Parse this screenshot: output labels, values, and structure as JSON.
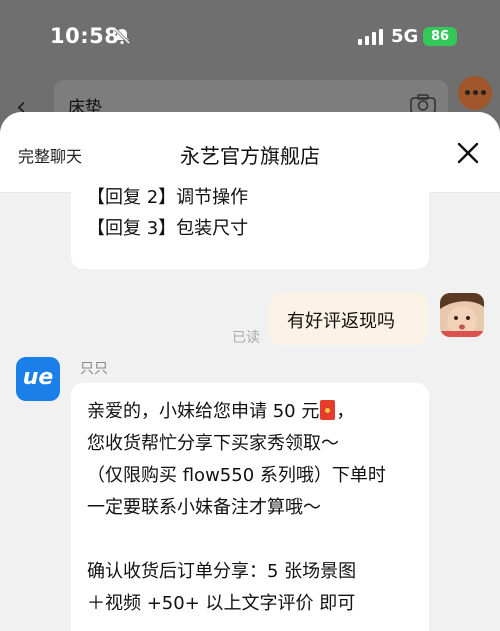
{
  "status_bar": {
    "time": "10:58",
    "network": "5G",
    "battery": "86"
  },
  "background_page": {
    "search_text": "床垫"
  },
  "sheet": {
    "full_chat_label": "完整聊天",
    "title": "永艺官方旗舰店"
  },
  "messages": {
    "shop_prev": [
      "【回复 2】调节操作",
      "【回复 3】包装尺寸"
    ],
    "mine": {
      "text": "有好评返现吗",
      "status": "已读"
    },
    "shop": {
      "sender": "只只",
      "logo_text": "ue",
      "line1_before": "亲爱的，小妹给您申请 50 元",
      "line1_after": "，",
      "lines": [
        "您收货帮忙分享下买家秀领取～",
        "（仅限购买 flow550 系列哦）下单时",
        "一定要联系小妹备注才算哦～",
        "",
        "确认收货后订单分享：5 张场景图",
        "＋视频 +50+ 以上文字评价 即可"
      ]
    }
  },
  "colors": {
    "shop_logo": "#1a7fe8",
    "battery": "#34c759",
    "mine_bubble": "#fdf2e6"
  }
}
